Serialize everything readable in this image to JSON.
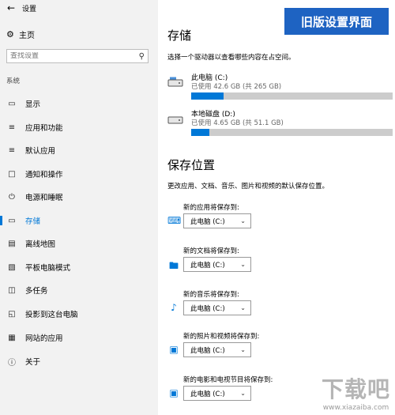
{
  "window": {
    "back_icon": "back-arrow-icon",
    "title": "设置"
  },
  "sidebar": {
    "home_label": "主页",
    "search_placeholder": "查找设置",
    "section_label": "系统",
    "items": [
      {
        "label": "显示",
        "icon": "display-icon"
      },
      {
        "label": "应用和功能",
        "icon": "apps-list-icon"
      },
      {
        "label": "默认应用",
        "icon": "default-apps-icon"
      },
      {
        "label": "通知和操作",
        "icon": "notifications-icon"
      },
      {
        "label": "电源和睡眠",
        "icon": "power-icon"
      },
      {
        "label": "存储",
        "icon": "storage-icon",
        "active": true
      },
      {
        "label": "离线地图",
        "icon": "map-icon"
      },
      {
        "label": "平板电脑模式",
        "icon": "tablet-icon"
      },
      {
        "label": "多任务",
        "icon": "multitask-icon"
      },
      {
        "label": "投影到这台电脑",
        "icon": "project-icon"
      },
      {
        "label": "网站的应用",
        "icon": "web-apps-icon"
      },
      {
        "label": "关于",
        "icon": "info-icon"
      }
    ]
  },
  "banner": {
    "text": "旧版设置界面",
    "color": "#1e63c2"
  },
  "storage": {
    "title": "存储",
    "description": "选择一个驱动器以查看哪些内容在占空间。",
    "drives": [
      {
        "name": "此电脑 (C:)",
        "used_text": "已使用 42.6 GB (共 265 GB)",
        "used_fraction": 0.161
      },
      {
        "name": "本地磁盘 (D:)",
        "used_text": "已使用 4.65 GB (共 51.1 GB)",
        "used_fraction": 0.091
      }
    ]
  },
  "save_locations": {
    "title": "保存位置",
    "description": "更改应用、文档、音乐、图片和视频的默认保存位置。",
    "items": [
      {
        "label": "新的应用将保存到:",
        "value": "此电脑 (C:)",
        "icon": "keyboard-icon"
      },
      {
        "label": "新的文档将保存到:",
        "value": "此电脑 (C:)",
        "icon": "folder-icon"
      },
      {
        "label": "新的音乐将保存到:",
        "value": "此电脑 (C:)",
        "icon": "music-note-icon"
      },
      {
        "label": "新的照片和视频将保存到:",
        "value": "此电脑 (C:)",
        "icon": "picture-icon"
      },
      {
        "label": "新的电影和电视节目将保存到:",
        "value": "此电脑 (C:)",
        "icon": "video-camera-icon"
      }
    ]
  },
  "watermark": {
    "line1": "下载吧",
    "line2": "www.xiazaiba.com"
  },
  "accent_color": "#0078d7"
}
